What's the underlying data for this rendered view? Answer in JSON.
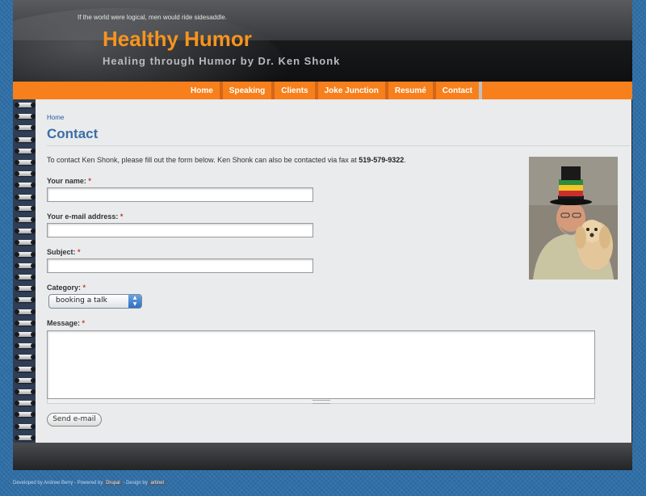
{
  "header": {
    "slogan": "If the world were logical, men would ride sidesaddle.",
    "site_name": "Healthy Humor",
    "site_slogan": "Healing through Humor by Dr. Ken Shonk"
  },
  "nav": {
    "items": [
      {
        "label": "Home"
      },
      {
        "label": "Speaking"
      },
      {
        "label": "Clients"
      },
      {
        "label": "Joke Junction"
      },
      {
        "label": "Resumé"
      },
      {
        "label": "Contact"
      }
    ]
  },
  "breadcrumb": {
    "home": "Home"
  },
  "page": {
    "title": "Contact",
    "intro": "To contact Ken Shonk, please fill out the form below. Ken Shonk can also be contacted via fax at",
    "fax": "519-579-9322",
    "intro_end": "."
  },
  "form": {
    "name_label": "Your name:",
    "email_label": "Your e-mail address:",
    "subject_label": "Subject:",
    "category_label": "Category:",
    "category_value": "booking a talk",
    "message_label": "Message:",
    "required_mark": "*",
    "submit_label": "Send e-mail",
    "name_value": "",
    "email_value": "",
    "subject_value": "",
    "message_value": ""
  },
  "footer": {
    "developed": "Developed by Andrew Berry - Powered by",
    "drupal": "Drupal",
    "design": "- Design by",
    "artinet": "artinet"
  },
  "colors": {
    "accent_orange": "#f7801c",
    "title_blue": "#3a6ea8",
    "site_name_orange": "#f7941d"
  }
}
